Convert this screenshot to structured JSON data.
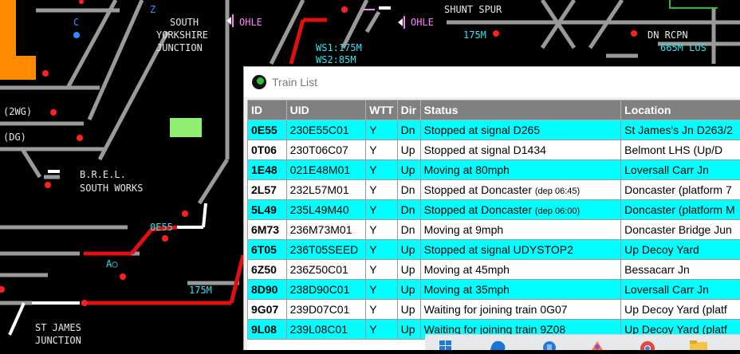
{
  "map": {
    "labels": {
      "south_yorkshire_junction_1": "SOUTH",
      "south_yorkshire_junction_2": "YORKSHIRE",
      "south_yorkshire_junction_3": "JUNCTION",
      "ohle_1": "OHLE",
      "ohle_2": "OHLE",
      "shunt_spur": "SHUNT SPUR",
      "ws1": "WS1:175M",
      "ws2": "WS2:85M",
      "dist_175m_top": "175M",
      "dn_rcpn": "DN RCPN",
      "los": "665M LOS",
      "c": "C",
      "z": "Z",
      "twowg": "(2WG)",
      "dg": "(DG)",
      "brel_1": "B.R.E.L.",
      "brel_2": "SOUTH WORKS",
      "train_0e55": "0E55",
      "ao": "A○",
      "dist_175m_bottom": "175M",
      "st_james_1": "ST JAMES",
      "st_james_2": "JUNCTION"
    }
  },
  "window": {
    "title": "Train List",
    "columns": [
      "ID",
      "UID",
      "WTT",
      "Dir",
      "Status",
      "Location"
    ],
    "rows": [
      {
        "id": "0E55",
        "uid": "230E55C01",
        "wtt": "Y",
        "dir": "Dn",
        "status": "Stopped at signal D265",
        "dep": "",
        "location": "St James's Jn D263/2",
        "color": "cyan"
      },
      {
        "id": "0T06",
        "uid": "230T06C07",
        "wtt": "Y",
        "dir": "Up",
        "status": "Stopped at signal D1434",
        "dep": "",
        "location": "Belmont LHS (Up/D",
        "color": "white"
      },
      {
        "id": "1E48",
        "uid": "021E48M01",
        "wtt": "Y",
        "dir": "Up",
        "status": "Moving at 80mph",
        "dep": "",
        "location": "Loversall Carr Jn",
        "color": "cyan"
      },
      {
        "id": "2L57",
        "uid": "232L57M01",
        "wtt": "Y",
        "dir": "Dn",
        "status": "Stopped at Doncaster",
        "dep": "(dep 06:45)",
        "location": "Doncaster (platform 7",
        "color": "white"
      },
      {
        "id": "5L49",
        "uid": "235L49M40",
        "wtt": "Y",
        "dir": "Dn",
        "status": "Stopped at Doncaster",
        "dep": "(dep 06:00)",
        "location": "Doncaster (platform M",
        "color": "cyan"
      },
      {
        "id": "6M73",
        "uid": "236M73M01",
        "wtt": "Y",
        "dir": "Dn",
        "status": "Moving at 9mph",
        "dep": "",
        "location": "Doncaster Bridge Jun",
        "color": "white"
      },
      {
        "id": "6T05",
        "uid": "236T05SEED",
        "wtt": "Y",
        "dir": "Up",
        "status": "Stopped at signal UDYSTOP2",
        "dep": "",
        "location": "Up Decoy Yard",
        "color": "cyan"
      },
      {
        "id": "6Z50",
        "uid": "236Z50C01",
        "wtt": "Y",
        "dir": "Up",
        "status": "Moving at 45mph",
        "dep": "",
        "location": "Bessacarr Jn",
        "color": "white"
      },
      {
        "id": "8D90",
        "uid": "238D90C01",
        "wtt": "Y",
        "dir": "Up",
        "status": "Moving at 35mph",
        "dep": "",
        "location": "Loversall Carr Jn",
        "color": "cyan"
      },
      {
        "id": "9G07",
        "uid": "239D07C01",
        "wtt": "Y",
        "dir": "Up",
        "status": "Waiting for joining train 0G07",
        "dep": "",
        "location": "Up Decoy Yard (platf",
        "color": "white"
      },
      {
        "id": "9L08",
        "uid": "239L08C01",
        "wtt": "Y",
        "dir": "Up",
        "status": "Waiting for joining train 9Z08",
        "dep": "",
        "location": "Up Decoy Yard (platf",
        "color": "cyan"
      }
    ]
  },
  "taskbar": {
    "icons": [
      "windows-icon",
      "edge-icon",
      "store-icon",
      "photos-icon",
      "chrome-icon",
      "folder-icon"
    ]
  },
  "colors": {
    "track_gray": "#9a9a9a",
    "track_red": "#e01010",
    "signal_red": "#ff2020",
    "label_cyan": "#2ee6f0",
    "platform_orange": "#ff8a00",
    "row_cyan": "#00ffff",
    "header_gray": "#808080"
  }
}
